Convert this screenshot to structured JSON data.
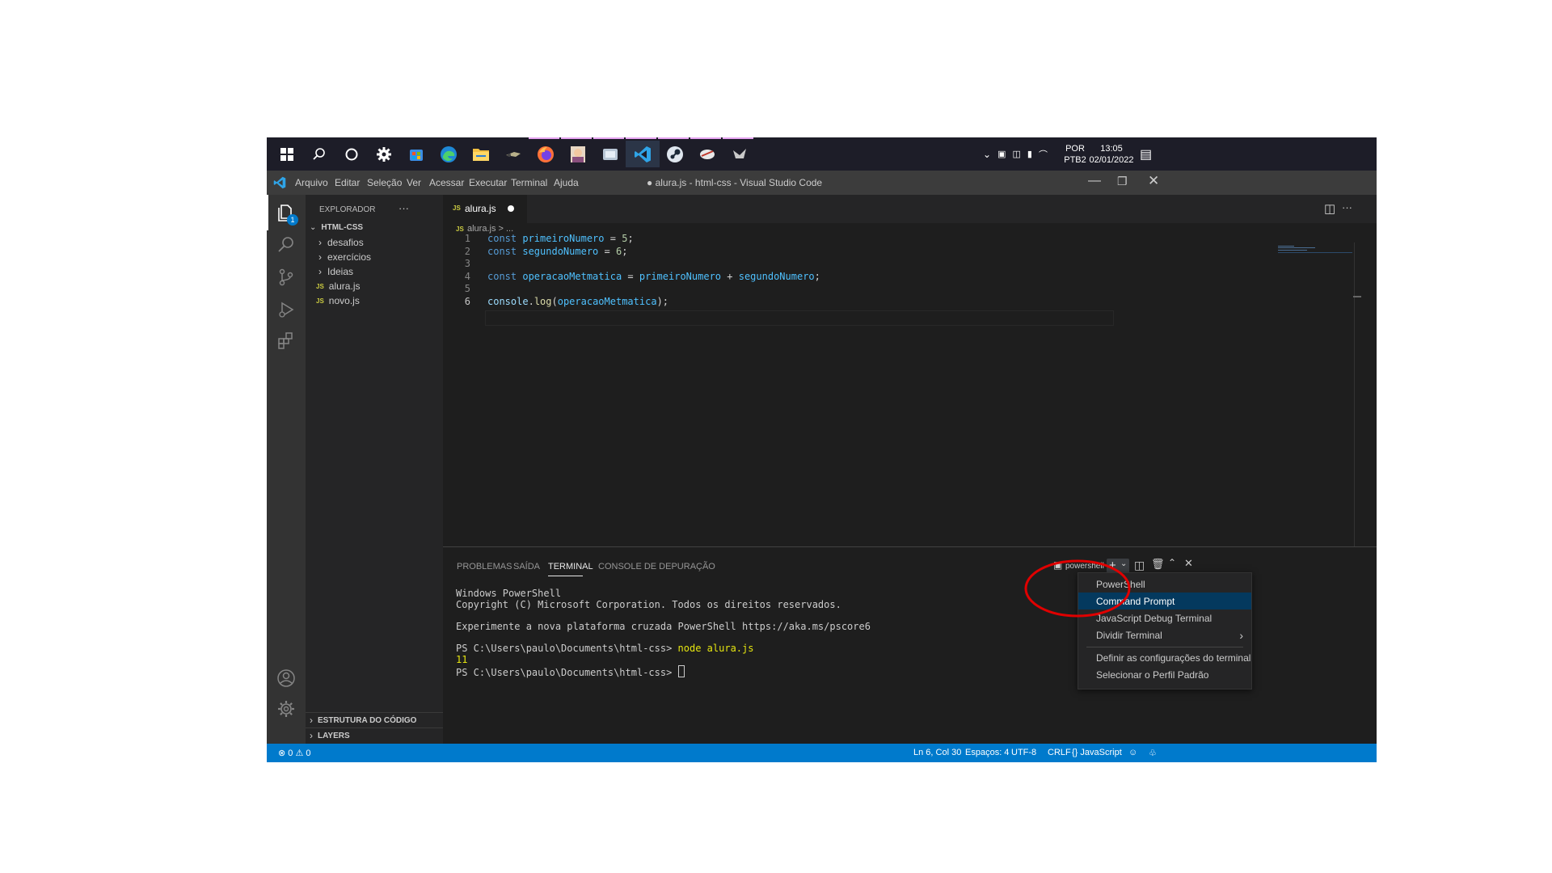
{
  "taskbar": {
    "icons": [
      "windows-start-icon",
      "search-icon",
      "cortana-icon",
      "settings-icon",
      "store-icon",
      "edge-icon",
      "file-explorer-icon",
      "app-icon",
      "firefox-icon",
      "app-icon",
      "app-icon",
      "vscode-icon",
      "steam-icon",
      "app-icon",
      "app-icon"
    ],
    "lang_top": "POR",
    "lang_bottom": "PTB2",
    "time": "13:05",
    "date": "02/01/2022"
  },
  "titlebar": {
    "menu": [
      "Arquivo",
      "Editar",
      "Seleção",
      "Ver",
      "Acessar",
      "Executar",
      "Terminal",
      "Ajuda"
    ],
    "title": "● alura.js - html-css - Visual Studio Code"
  },
  "sidebar": {
    "header": "EXPLORADOR",
    "more": "···",
    "root": "HTML-CSS",
    "folders": [
      "desafios",
      "exercícios",
      "Ideias"
    ],
    "files": [
      "alura.js",
      "novo.js"
    ],
    "js_badge": "JS",
    "outline": "ESTRUTURA DO CÓDIGO",
    "layers": "LAYERS",
    "explorer_badge": "1"
  },
  "editor": {
    "tab_label": "alura.js",
    "breadcrumb": "alura.js > ...",
    "lines": [
      {
        "n": "1",
        "tokens": [
          [
            "kw",
            "const "
          ],
          [
            "var",
            "primeiroNumero"
          ],
          [
            "pl",
            " = "
          ],
          [
            "num",
            "5"
          ],
          [
            "pl",
            ";"
          ]
        ]
      },
      {
        "n": "2",
        "tokens": [
          [
            "kw",
            "const "
          ],
          [
            "var",
            "segundoNumero"
          ],
          [
            "pl",
            " = "
          ],
          [
            "num",
            "6"
          ],
          [
            "pl",
            ";"
          ]
        ]
      },
      {
        "n": "3",
        "tokens": []
      },
      {
        "n": "4",
        "tokens": [
          [
            "kw",
            "const "
          ],
          [
            "var",
            "operacaoMetmatica"
          ],
          [
            "pl",
            " = "
          ],
          [
            "var",
            "primeiroNumero"
          ],
          [
            "pl",
            " + "
          ],
          [
            "var",
            "segundoNumero"
          ],
          [
            "pl",
            ";"
          ]
        ]
      },
      {
        "n": "5",
        "tokens": []
      },
      {
        "n": "6",
        "tokens": [
          [
            "obj",
            "console"
          ],
          [
            "pl",
            "."
          ],
          [
            "fn",
            "log"
          ],
          [
            "pl",
            "("
          ],
          [
            "var",
            "operacaoMetmatica"
          ],
          [
            "pl",
            ");"
          ]
        ]
      }
    ]
  },
  "panel": {
    "tabs": [
      "PROBLEMAS",
      "SAÍDA",
      "TERMINAL",
      "CONSOLE DE DEPURAÇÃO"
    ],
    "active_tab": "TERMINAL",
    "shell": "powershell",
    "terminal": [
      "Windows PowerShell",
      "Copyright (C) Microsoft Corporation. Todos os direitos reservados.",
      "",
      "Experimente a nova plataforma cruzada PowerShell https://aka.ms/pscore6",
      "",
      "PS C:\\Users\\paulo\\Documents\\html-css> node alura.js",
      "11",
      "PS C:\\Users\\paulo\\Documents\\html-css> "
    ],
    "prompt": "PS C:\\Users\\paulo\\Documents\\html-css> ",
    "command": "node alura.js",
    "output": "11"
  },
  "dropdown": {
    "items": [
      "PowerShell",
      "Command Prompt",
      "JavaScript Debug Terminal",
      "Dividir Terminal",
      "Definir as configurações do terminal",
      "Selecionar o Perfil Padrão"
    ],
    "selected": "Command Prompt"
  },
  "statusbar": {
    "errors": "0",
    "warnings": "0",
    "position": "Ln 6, Col 30",
    "spaces": "Espaços: 4",
    "encoding": "UTF-8",
    "eol": "CRLF",
    "language": "JavaScript"
  },
  "colors": {
    "accent": "#007acc",
    "annotation": "#e00000",
    "menu_selected": "#04395e"
  }
}
